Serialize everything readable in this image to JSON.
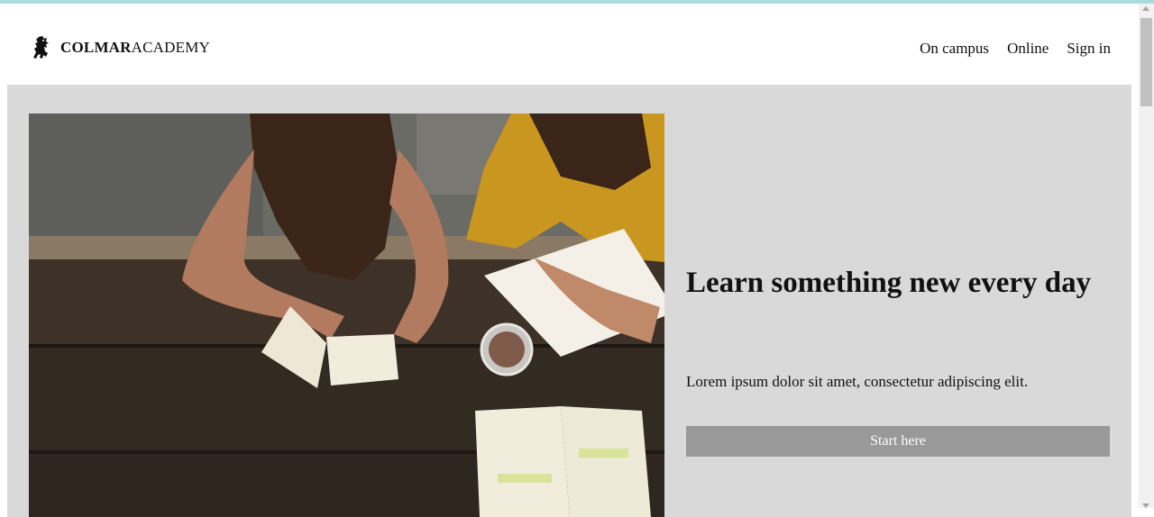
{
  "brand": {
    "name_bold": "COLMAR",
    "name_regular": "ACADEMY",
    "logo_icon": "lion-rampant-icon"
  },
  "nav": {
    "items": [
      {
        "label": "On campus"
      },
      {
        "label": "Online"
      },
      {
        "label": "Sign in"
      }
    ]
  },
  "hero": {
    "headline": "Learn something new every day",
    "lede": "Lorem ipsum dolor sit amet, consectetur adipiscing elit.",
    "cta_label": "Start here",
    "photo_icon": "students-studying-photo",
    "background_color": "#d9d9d9",
    "cta_color": "#999999"
  }
}
